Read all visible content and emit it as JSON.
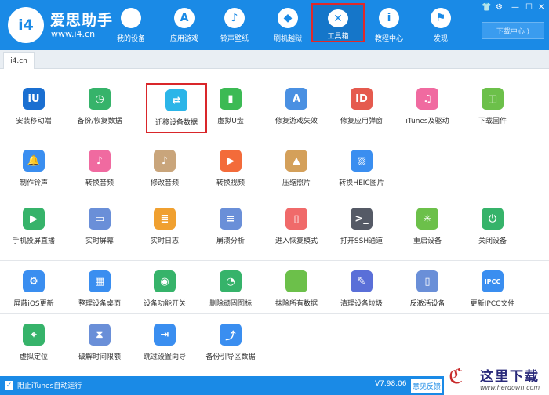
{
  "header": {
    "logo_text": "i4",
    "app_name": "爱思助手",
    "app_url": "www.i4.cn",
    "nav": [
      {
        "label": "我的设备",
        "icon": "apple-icon",
        "glyph": ""
      },
      {
        "label": "应用游戏",
        "icon": "app-store-icon",
        "glyph": "A"
      },
      {
        "label": "铃声壁纸",
        "icon": "music-wallpaper-icon",
        "glyph": "♪"
      },
      {
        "label": "刷机越狱",
        "icon": "dropbox-icon",
        "glyph": "◆"
      },
      {
        "label": "工具箱",
        "icon": "tools-icon",
        "glyph": "✕"
      },
      {
        "label": "教程中心",
        "icon": "info-icon",
        "glyph": "i"
      },
      {
        "label": "发现",
        "icon": "flag-icon",
        "glyph": "⚑"
      }
    ],
    "window_controls": [
      "👕",
      "⚙",
      "—",
      "☐",
      "✕"
    ],
    "download_center": "下载中心 ⟩"
  },
  "tabs": [
    {
      "label": "i4.cn"
    }
  ],
  "sections": [
    {
      "tools": [
        {
          "label": "安装移动端",
          "icon": "i4-mobile-icon",
          "glyph": "iU",
          "color": "#1a6fd1"
        },
        {
          "label": "备份/恢复数据",
          "icon": "backup-restore-icon",
          "glyph": "◷",
          "color": "#36b36a"
        },
        {
          "label": "迁移设备数据",
          "icon": "migrate-data-icon",
          "glyph": "⇄",
          "color": "#2bb5e8"
        },
        {
          "label": "虚拟U盘",
          "icon": "usb-drive-icon",
          "glyph": "▮",
          "color": "#3cba54"
        },
        {
          "label": "修复游戏失效",
          "icon": "fix-game-icon",
          "glyph": "A",
          "color": "#4a90e2"
        },
        {
          "label": "修复应用弹窗",
          "icon": "fix-app-popup-icon",
          "glyph": "ID",
          "color": "#e55a4e"
        },
        {
          "label": "iTunes及驱动",
          "icon": "itunes-icon",
          "glyph": "♫",
          "color": "#f06aa0"
        },
        {
          "label": "下载固件",
          "icon": "firmware-icon",
          "glyph": "◫",
          "color": "#6cc04a"
        }
      ]
    },
    {
      "tools": [
        {
          "label": "制作铃声",
          "icon": "ringtone-bell-icon",
          "glyph": "🔔",
          "color": "#3a8ef0"
        },
        {
          "label": "转换音频",
          "icon": "convert-audio-icon",
          "glyph": "♪",
          "color": "#f06aa0"
        },
        {
          "label": "修改音频",
          "icon": "edit-audio-icon",
          "glyph": "♪",
          "color": "#c9a57b"
        },
        {
          "label": "转换视频",
          "icon": "convert-video-icon",
          "glyph": "▶",
          "color": "#f36b3a"
        },
        {
          "label": "压缩照片",
          "icon": "compress-photo-icon",
          "glyph": "▲",
          "color": "#d4a05a"
        },
        {
          "label": "转换HEIC图片",
          "icon": "heic-convert-icon",
          "glyph": "▨",
          "color": "#3a8ef0"
        }
      ]
    },
    {
      "tools": [
        {
          "label": "手机投屏直播",
          "icon": "screen-cast-icon",
          "glyph": "▶",
          "color": "#36b36a"
        },
        {
          "label": "实时屏幕",
          "icon": "realtime-screen-icon",
          "glyph": "▭",
          "color": "#6a8fd8"
        },
        {
          "label": "实时日志",
          "icon": "realtime-log-icon",
          "glyph": "≣",
          "color": "#f0a030"
        },
        {
          "label": "崩溃分析",
          "icon": "crash-analysis-icon",
          "glyph": "≡",
          "color": "#6a8fd8"
        },
        {
          "label": "进入恢复模式",
          "icon": "recovery-mode-icon",
          "glyph": "▯",
          "color": "#f06a6a"
        },
        {
          "label": "打开SSH通道",
          "icon": "ssh-tunnel-icon",
          "glyph": ">_",
          "color": "#555a66"
        },
        {
          "label": "重启设备",
          "icon": "restart-device-icon",
          "glyph": "✳",
          "color": "#6cc04a"
        },
        {
          "label": "关闭设备",
          "icon": "power-off-icon",
          "glyph": "⏻",
          "color": "#36b36a"
        }
      ]
    },
    {
      "tools": [
        {
          "label": "屏蔽iOS更新",
          "icon": "block-ios-update-icon",
          "glyph": "⚙",
          "color": "#3a8ef0"
        },
        {
          "label": "整理设备桌面",
          "icon": "organize-desktop-icon",
          "glyph": "▦",
          "color": "#3a8ef0"
        },
        {
          "label": "设备功能开关",
          "icon": "feature-toggle-icon",
          "glyph": "◉",
          "color": "#36b36a"
        },
        {
          "label": "删除顽固图标",
          "icon": "delete-icon-icon",
          "glyph": "◔",
          "color": "#36b36a"
        },
        {
          "label": "抹除所有数据",
          "icon": "erase-data-icon",
          "glyph": "",
          "color": "#6cc04a"
        },
        {
          "label": "清理设备垃圾",
          "icon": "clean-junk-icon",
          "glyph": "✎",
          "color": "#5a6fd8"
        },
        {
          "label": "反激活设备",
          "icon": "deactivate-device-icon",
          "glyph": "▯",
          "color": "#6a8fd8"
        },
        {
          "label": "更新IPCC文件",
          "icon": "ipcc-update-icon",
          "glyph": "IPCC",
          "color": "#3a8ef0"
        }
      ]
    },
    {
      "tools": [
        {
          "label": "虚拟定位",
          "icon": "virtual-location-icon",
          "glyph": "⌖",
          "color": "#36b36a"
        },
        {
          "label": "破解时间限额",
          "icon": "time-limit-icon",
          "glyph": "⧗",
          "color": "#6a8fd8"
        },
        {
          "label": "跳过设置向导",
          "icon": "skip-setup-icon",
          "glyph": "⇥",
          "color": "#3a8ef0"
        },
        {
          "label": "备份引导区数据",
          "icon": "boot-backup-icon",
          "glyph": "⤴",
          "color": "#3a8ef0"
        }
      ]
    }
  ],
  "footer": {
    "checkbox_checked": "✓",
    "auto_run_label": "阻止iTunes自动运行",
    "version": "V7.98.06",
    "feedback": "意见反馈"
  },
  "watermark": {
    "mark": "ℭ",
    "title": "这里下载",
    "url": "www.herdown.com"
  }
}
